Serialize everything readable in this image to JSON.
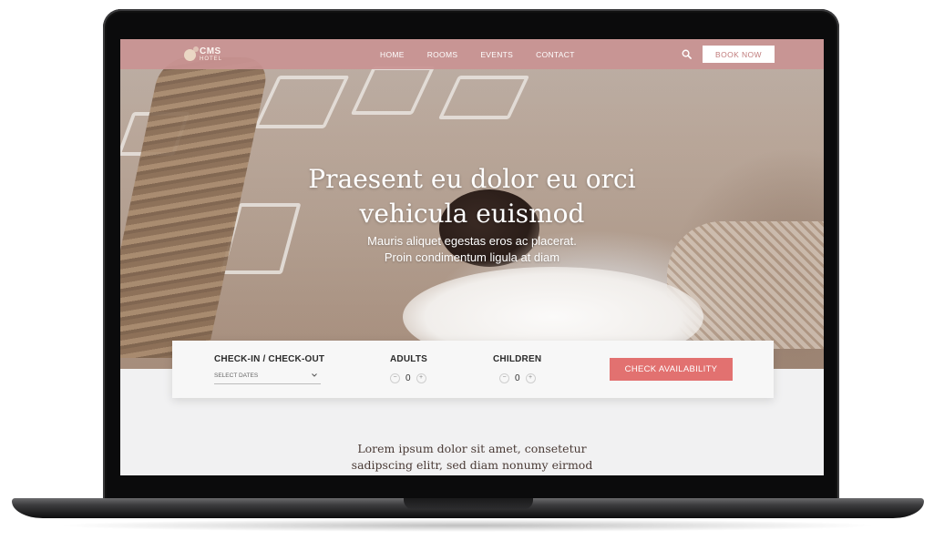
{
  "header": {
    "logo_main": "CMS",
    "logo_sub": "HOTEL",
    "nav": [
      "HOME",
      "ROOMS",
      "EVENTS",
      "CONTACT"
    ],
    "search_icon": "search-icon",
    "book_label": "BOOK NOW"
  },
  "hero": {
    "title_line1": "Praesent eu dolor eu orci",
    "title_line2": "vehicula euismod",
    "sub_line1": "Mauris aliquet egestas eros ac placerat.",
    "sub_line2": "Proin condimentum ligula at diam"
  },
  "booking": {
    "checkin_label": "CHECK-IN / CHECK-OUT",
    "dates_value": "SELECT DATES",
    "adults_label": "ADULTS",
    "adults_value": "0",
    "children_label": "CHILDREN",
    "children_value": "0",
    "minus": "−",
    "plus": "+",
    "check_label": "CHECK AVAILABILITY"
  },
  "intro": {
    "line1": "Lorem ipsum dolor sit amet, consetetur",
    "line2": "sadipscing elitr, sed diam nonumy eirmod"
  },
  "colors": {
    "header_bg": "#c99292",
    "cta": "#e27170",
    "book_text": "#c07b7b"
  }
}
